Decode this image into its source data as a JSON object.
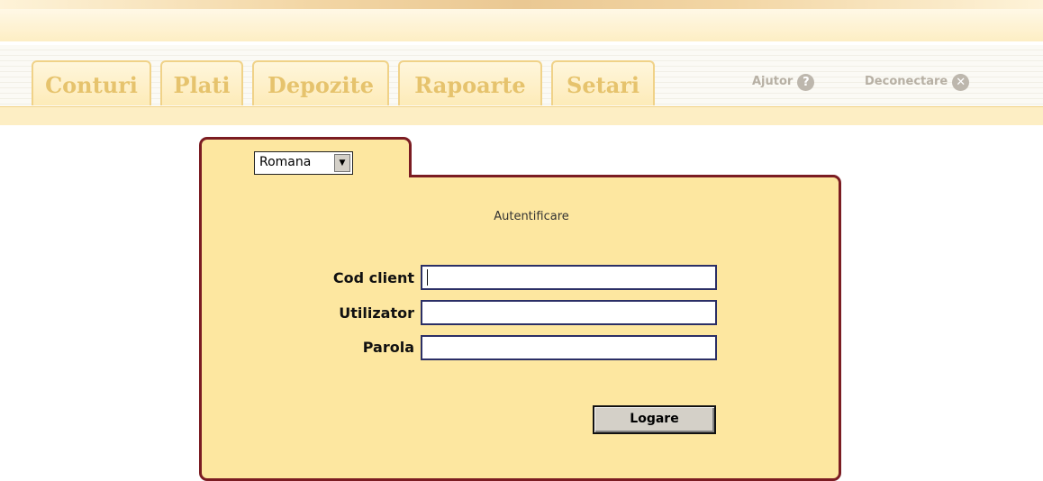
{
  "tabs": [
    {
      "label": "Conturi"
    },
    {
      "label": "Plati"
    },
    {
      "label": "Depozite"
    },
    {
      "label": "Rapoarte"
    },
    {
      "label": "Setari"
    }
  ],
  "header_links": {
    "help": {
      "label": "Ajutor",
      "icon": "help-icon"
    },
    "logout": {
      "label": "Deconectare",
      "icon": "close-icon"
    }
  },
  "login": {
    "language": {
      "selected": "Romana"
    },
    "title": "Autentificare",
    "fields": {
      "client_code": {
        "label": "Cod client",
        "value": ""
      },
      "user": {
        "label": "Utilizator",
        "value": ""
      },
      "password": {
        "label": "Parola",
        "value": ""
      }
    },
    "submit_label": "Logare"
  },
  "colors": {
    "panel_bg": "#fde7a0",
    "panel_border": "#7b1c22",
    "tab_text": "#e6c36d",
    "field_border": "#2b2f66"
  }
}
